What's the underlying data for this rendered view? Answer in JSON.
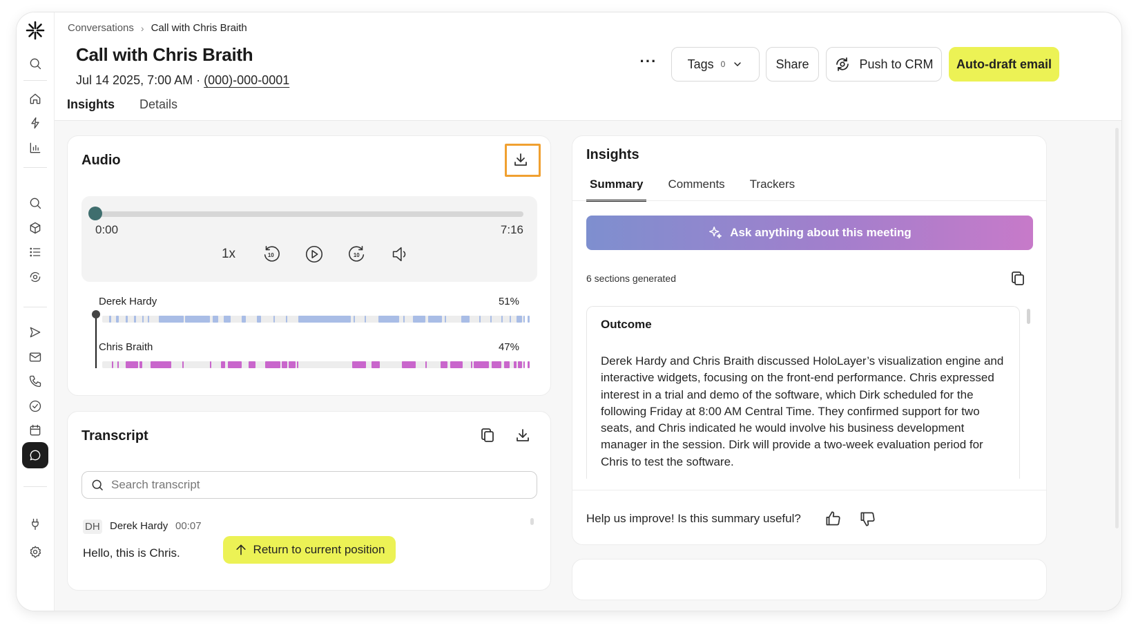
{
  "breadcrumb": {
    "parent": "Conversations",
    "separator": "›",
    "current": "Call with Chris Braith"
  },
  "page": {
    "title": "Call with Chris Braith",
    "datetime": "Jul 14 2025, 7:00 AM ·",
    "phone": "(000)-000-0001"
  },
  "tabs": [
    "Insights",
    "Details"
  ],
  "toolbar": {
    "more": "···",
    "tags_label": "Tags",
    "tags_count": "0",
    "share_label": "Share",
    "crm_label": "Push to CRM",
    "email_label": "Auto-draft email"
  },
  "colors": {
    "accent_yellow": "#ecf255",
    "highlight": "#f0a030",
    "speaker_a": "#a9bde6",
    "speaker_b": "#c966cc",
    "knob": "#3f6e6e"
  },
  "audio": {
    "title": "Audio",
    "current_time": "0:00",
    "duration": "7:16",
    "progress": 0.0,
    "speed": "1x",
    "speakers": [
      {
        "name": "Derek Hardy",
        "percent": "51%"
      },
      {
        "name": "Chris Braith",
        "percent": "47%"
      }
    ]
  },
  "transcript": {
    "title": "Transcript",
    "search_placeholder": "Search transcript",
    "entries": [
      {
        "initials": "DH",
        "speaker": "Derek Hardy",
        "time": "00:07",
        "text": "Hello, this is Chris."
      }
    ],
    "return_label": "Return to current position"
  },
  "insights": {
    "title": "Insights",
    "tabs": [
      "Summary",
      "Comments",
      "Trackers"
    ],
    "ask_label": "Ask anything about this meeting",
    "sections_generated": "6 sections generated",
    "outcome_title": "Outcome",
    "outcome_text": "Derek Hardy and Chris Braith discussed HoloLayer’s visualization engine and interactive widgets, focusing on the front-end performance. Chris expressed interest in a trial and demo of the software, which Dirk scheduled for the following Friday at 8:00 AM Central Time. They confirmed support for two seats, and Chris indicated he would involve his business development manager in the session. Dirk will provide a two-week evaluation period for Chris to test the software.",
    "feedback_prompt": "Help us improve! Is this summary useful?"
  }
}
